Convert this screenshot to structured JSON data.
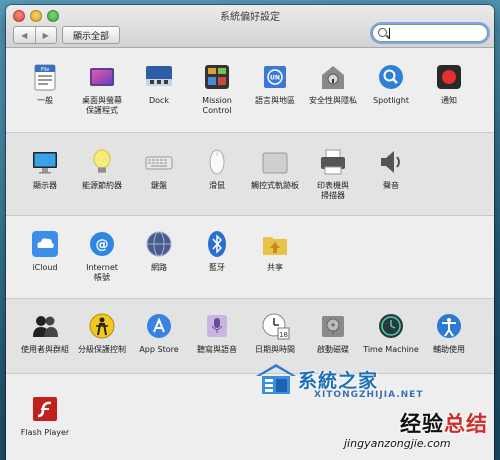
{
  "window": {
    "title": "系統偏好設定"
  },
  "toolbar": {
    "back": "◀",
    "forward": "▶",
    "show_all": "顯示全部"
  },
  "search": {
    "value": "",
    "placeholder": ""
  },
  "rows": [
    {
      "items": [
        {
          "label": "一般",
          "icon": "general-icon"
        },
        {
          "label": "桌面與螢幕\n保護程式",
          "icon": "desktop-screensaver-icon"
        },
        {
          "label": "Dock",
          "icon": "dock-icon"
        },
        {
          "label": "Mission\nControl",
          "icon": "mission-control-icon"
        },
        {
          "label": "語言與地區",
          "icon": "language-region-icon",
          "badge": "UN"
        },
        {
          "label": "安全性與隱私",
          "icon": "security-privacy-icon"
        },
        {
          "label": "Spotlight",
          "icon": "spotlight-icon"
        },
        {
          "label": "通知",
          "icon": "notifications-icon"
        }
      ]
    },
    {
      "items": [
        {
          "label": "顯示器",
          "icon": "displays-icon"
        },
        {
          "label": "能源節約器",
          "icon": "energy-saver-icon"
        },
        {
          "label": "鍵盤",
          "icon": "keyboard-icon"
        },
        {
          "label": "滑鼠",
          "icon": "mouse-icon"
        },
        {
          "label": "觸控式軌跡板",
          "icon": "trackpad-icon"
        },
        {
          "label": "印表機與\n掃描器",
          "icon": "printers-scanners-icon"
        },
        {
          "label": "聲音",
          "icon": "sound-icon"
        }
      ]
    },
    {
      "items": [
        {
          "label": "iCloud",
          "icon": "icloud-icon"
        },
        {
          "label": "Internet\n帳號",
          "icon": "internet-accounts-icon"
        },
        {
          "label": "網路",
          "icon": "network-icon"
        },
        {
          "label": "藍牙",
          "icon": "bluetooth-icon"
        },
        {
          "label": "共享",
          "icon": "sharing-icon"
        }
      ]
    },
    {
      "items": [
        {
          "label": "使用者與群組",
          "icon": "users-groups-icon"
        },
        {
          "label": "分級保護控制",
          "icon": "parental-controls-icon"
        },
        {
          "label": "App Store",
          "icon": "app-store-icon"
        },
        {
          "label": "聽寫與語音",
          "icon": "dictation-speech-icon"
        },
        {
          "label": "日期與時間",
          "icon": "date-time-icon",
          "badge": "18"
        },
        {
          "label": "啟動磁碟",
          "icon": "startup-disk-icon"
        },
        {
          "label": "Time Machine",
          "icon": "time-machine-icon"
        },
        {
          "label": "輔助使用",
          "icon": "accessibility-icon"
        }
      ]
    },
    {
      "items": [
        {
          "label": "Flash Player",
          "icon": "flash-player-icon"
        }
      ]
    }
  ],
  "watermarks": {
    "site_cn": "系統之家",
    "site_pinyin": "XITONGZHIJIA.NET",
    "jy_black": "经验",
    "jy_red": "总结",
    "jy_url": "jingyanzongjie.com"
  }
}
